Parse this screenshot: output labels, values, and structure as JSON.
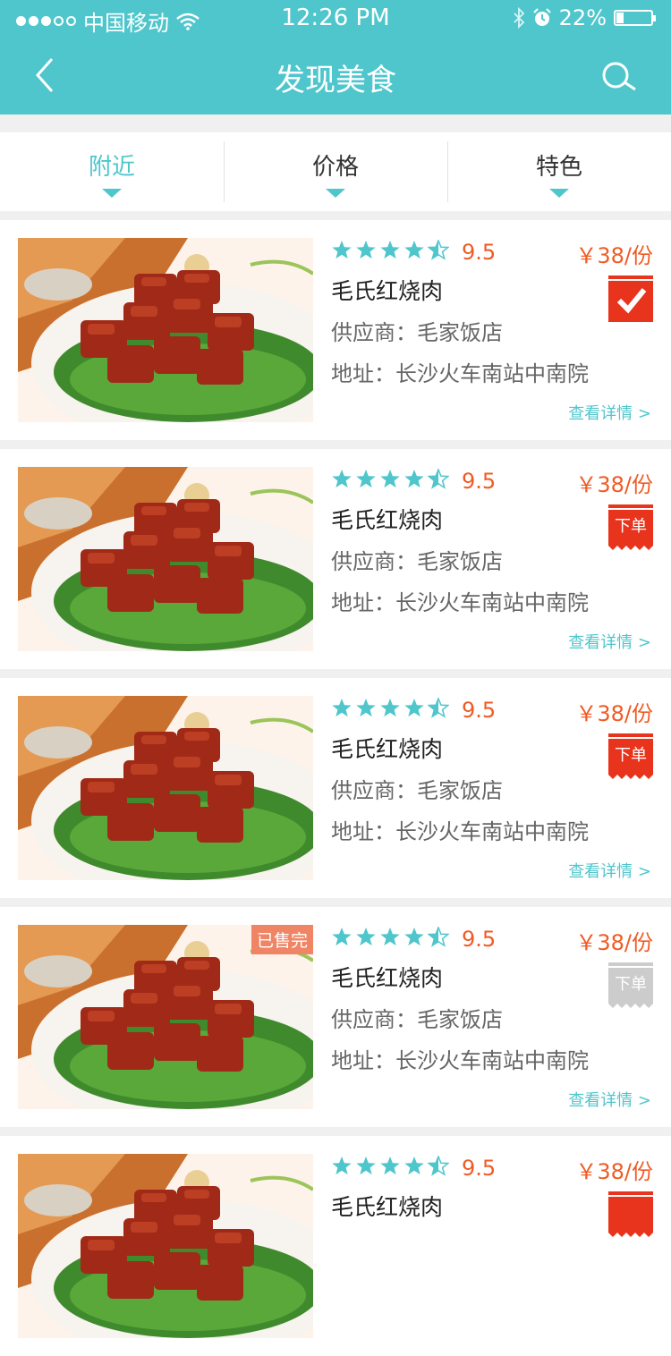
{
  "status": {
    "carrier": "中国移动",
    "time": "12:26 PM",
    "battery": "22%",
    "battery_level": 0.22
  },
  "nav": {
    "title": "发现美食"
  },
  "filters": [
    {
      "label": "附近",
      "active": true
    },
    {
      "label": "价格",
      "active": false
    },
    {
      "label": "特色",
      "active": false
    }
  ],
  "items": [
    {
      "name": "毛氏红烧肉",
      "score": "9.5",
      "rating": 4.5,
      "price": "￥38/份",
      "supplier": "供应商：毛家饭店",
      "address": "地址：长沙火车南站中南院",
      "detail": "查看详情 >",
      "order_state": "checked",
      "order_label": "",
      "sold_out": ""
    },
    {
      "name": "毛氏红烧肉",
      "score": "9.5",
      "rating": 4.5,
      "price": "￥38/份",
      "supplier": "供应商：毛家饭店",
      "address": "地址：长沙火车南站中南院",
      "detail": "查看详情 >",
      "order_state": "active",
      "order_label": "下单",
      "sold_out": ""
    },
    {
      "name": "毛氏红烧肉",
      "score": "9.5",
      "rating": 4.5,
      "price": "￥38/份",
      "supplier": "供应商：毛家饭店",
      "address": "地址：长沙火车南站中南院",
      "detail": "查看详情 >",
      "order_state": "active",
      "order_label": "下单",
      "sold_out": ""
    },
    {
      "name": "毛氏红烧肉",
      "score": "9.5",
      "rating": 4.5,
      "price": "￥38/份",
      "supplier": "供应商：毛家饭店",
      "address": "地址：长沙火车南站中南院",
      "detail": "查看详情 >",
      "order_state": "disabled",
      "order_label": "下单",
      "sold_out": "已售完"
    },
    {
      "name": "毛氏红烧肉",
      "score": "9.5",
      "rating": 4.5,
      "price": "￥38/份",
      "supplier": "",
      "address": "",
      "detail": "",
      "order_state": "active",
      "order_label": "",
      "sold_out": ""
    }
  ],
  "colors": {
    "primary": "#4fc6cc",
    "accent": "#f05b24",
    "order_red": "#e8341c",
    "disabled": "#cccccc"
  }
}
